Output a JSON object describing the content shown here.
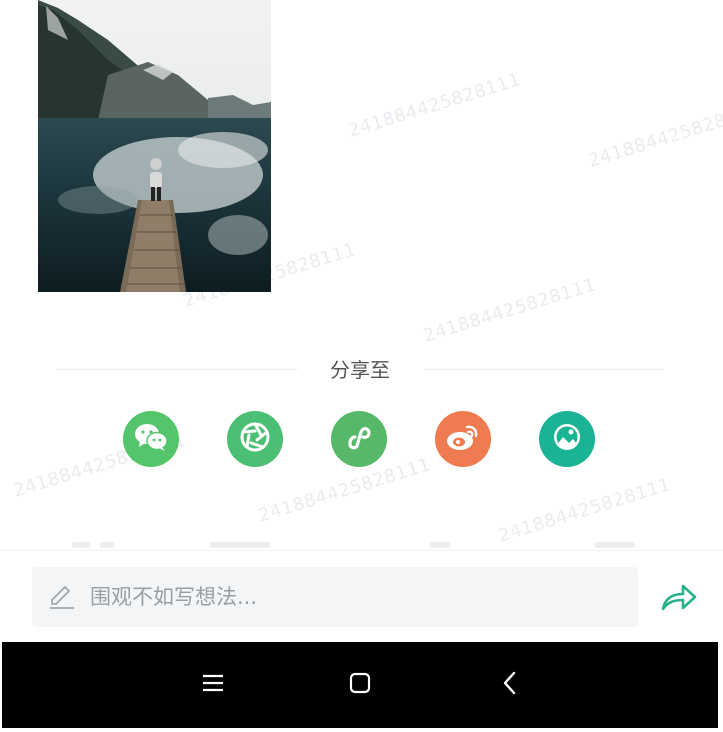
{
  "share": {
    "title": "分享至",
    "targets": [
      {
        "name": "wechat",
        "icon": "wechat-icon",
        "color": "#55c56b"
      },
      {
        "name": "moments",
        "icon": "aperture-icon",
        "color": "#4bbf73"
      },
      {
        "name": "mini-program",
        "icon": "link-icon",
        "color": "#58b86a"
      },
      {
        "name": "weibo",
        "icon": "weibo-icon",
        "color": "#ee7c50"
      },
      {
        "name": "save-image",
        "icon": "gallery-icon",
        "color": "#1ab394"
      }
    ]
  },
  "comment": {
    "placeholder": "围观不如写想法..."
  },
  "watermark": {
    "text": "241884425828111"
  },
  "navbar": {
    "buttons": [
      "menu-icon",
      "home-icon",
      "back-icon"
    ]
  }
}
